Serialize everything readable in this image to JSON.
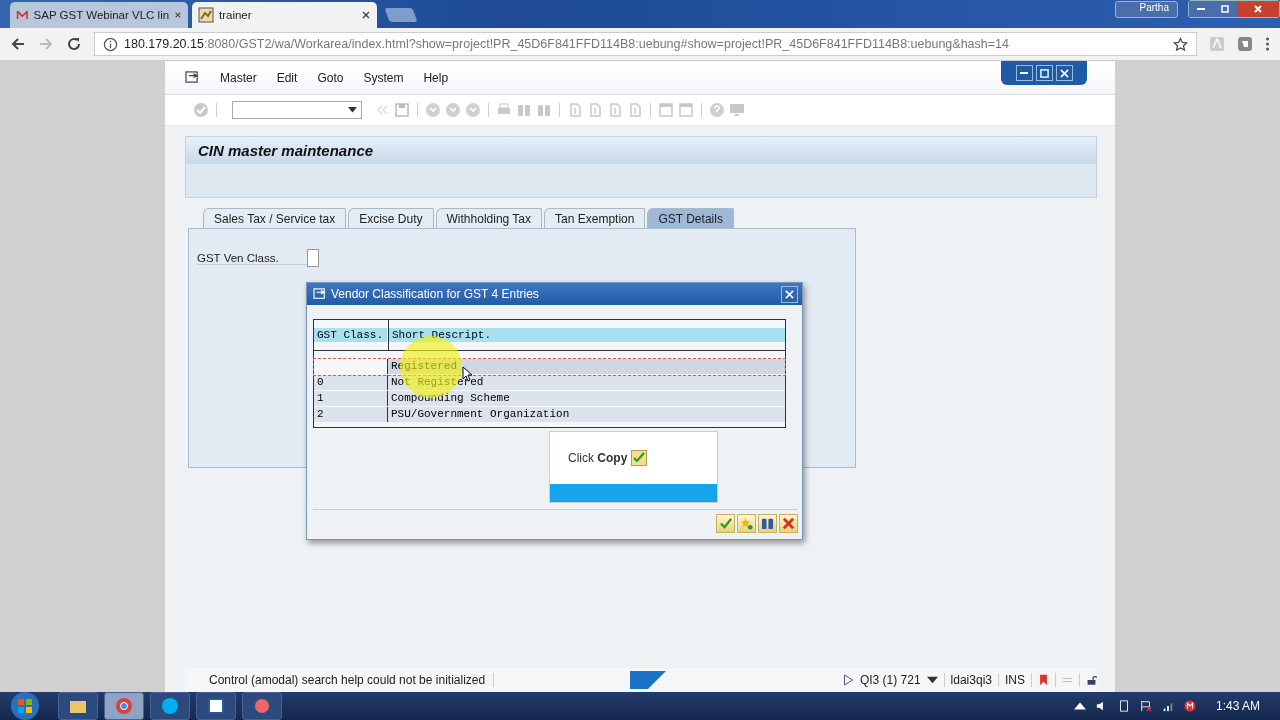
{
  "browser": {
    "tabs": [
      {
        "title": "SAP GST Webinar VLC lin",
        "selected": false
      },
      {
        "title": "trainer",
        "selected": true
      }
    ],
    "user": "Partha",
    "url_host": "180.179.20.15",
    "url_rest": ":8080/GST2/wa/Workarea/index.html?show=project!PR_45D6F841FFD114B8:uebung#show=project!PR_45D6F841FFD114B8:uebung&hash=14"
  },
  "menu": [
    "Master",
    "Edit",
    "Goto",
    "System",
    "Help"
  ],
  "screen_title": "CIN master maintenance",
  "tabs": [
    {
      "label": "Sales Tax / Service tax",
      "selected": false
    },
    {
      "label": "Excise Duty",
      "selected": false
    },
    {
      "label": "Withholding Tax",
      "selected": false
    },
    {
      "label": "Tan Exemption",
      "selected": false
    },
    {
      "label": "GST Details",
      "selected": true
    }
  ],
  "field": {
    "label": "GST Ven Class."
  },
  "dialog": {
    "title": "Vendor Classification for GST 4 Entries",
    "columns": [
      "GST Class.",
      "Short Descript."
    ],
    "rows": [
      {
        "class": "",
        "description": "Registered",
        "selected": true
      },
      {
        "class": "0",
        "description": "Not Registered",
        "selected": false
      },
      {
        "class": "1",
        "description": "Compounding Scheme",
        "selected": false
      },
      {
        "class": "2",
        "description": "PSU/Government Organization",
        "selected": false
      }
    ]
  },
  "callout": {
    "text": "Click **Copy**"
  },
  "status_bar": {
    "message": "Control (amodal) search help could not be initialized",
    "system": "QI3 (1) 721",
    "user": "ldai3qi3",
    "mode": "INS"
  },
  "taskbar": {
    "clock": "1:43 AM"
  }
}
